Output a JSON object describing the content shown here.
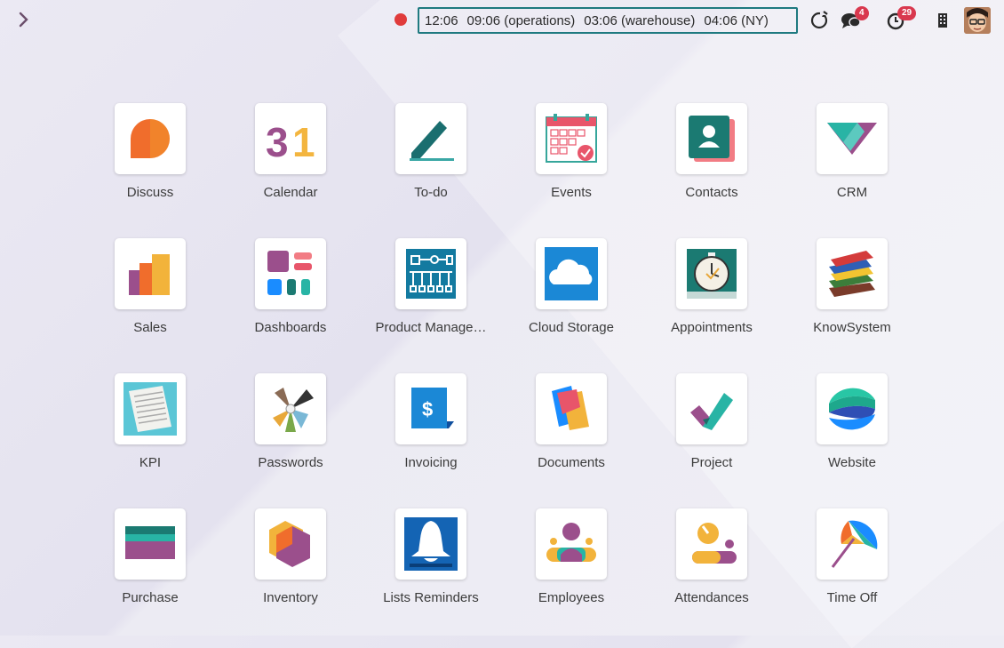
{
  "topbar": {
    "clocks": [
      "12:06",
      "09:06 (operations)",
      "03:06 (warehouse)",
      "04:06 (NY)"
    ],
    "messages_badge": "4",
    "activities_badge": "29"
  },
  "apps": [
    {
      "label": "Discuss",
      "icon": "discuss-icon"
    },
    {
      "label": "Calendar",
      "icon": "calendar-icon"
    },
    {
      "label": "To-do",
      "icon": "todo-icon"
    },
    {
      "label": "Events",
      "icon": "events-icon"
    },
    {
      "label": "Contacts",
      "icon": "contacts-icon"
    },
    {
      "label": "CRM",
      "icon": "crm-icon"
    },
    {
      "label": "Sales",
      "icon": "sales-icon"
    },
    {
      "label": "Dashboards",
      "icon": "dashboards-icon"
    },
    {
      "label": "Product Manage…",
      "icon": "product-management-icon"
    },
    {
      "label": "Cloud Storage",
      "icon": "cloud-storage-icon"
    },
    {
      "label": "Appointments",
      "icon": "appointments-icon"
    },
    {
      "label": "KnowSystem",
      "icon": "knowsystem-icon"
    },
    {
      "label": "KPI",
      "icon": "kpi-icon"
    },
    {
      "label": "Passwords",
      "icon": "passwords-icon"
    },
    {
      "label": "Invoicing",
      "icon": "invoicing-icon"
    },
    {
      "label": "Documents",
      "icon": "documents-icon"
    },
    {
      "label": "Project",
      "icon": "project-icon"
    },
    {
      "label": "Website",
      "icon": "website-icon"
    },
    {
      "label": "Purchase",
      "icon": "purchase-icon"
    },
    {
      "label": "Inventory",
      "icon": "inventory-icon"
    },
    {
      "label": "Lists Reminders",
      "icon": "lists-reminders-icon"
    },
    {
      "label": "Employees",
      "icon": "employees-icon"
    },
    {
      "label": "Attendances",
      "icon": "attendances-icon"
    },
    {
      "label": "Time Off",
      "icon": "time-off-icon"
    }
  ]
}
